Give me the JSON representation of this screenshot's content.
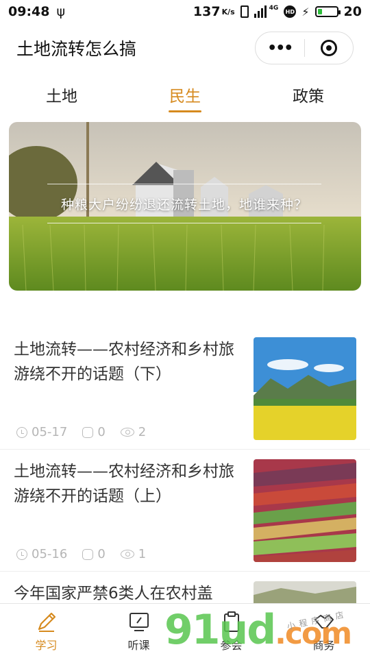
{
  "status_bar": {
    "time": "09:48",
    "usb_icon": "ψ",
    "network_speed": "137",
    "network_unit": "K/s",
    "signal_label": "4G",
    "battery": "20"
  },
  "title_bar": {
    "title": "土地流转怎么搞",
    "more_glyph": "•••"
  },
  "tabs": [
    {
      "label": "土地",
      "active": false
    },
    {
      "label": "民生",
      "active": true
    },
    {
      "label": "政策",
      "active": false
    }
  ],
  "banner": {
    "caption": "种粮大户纷纷退还流转土地，地谁来种？"
  },
  "articles": [
    {
      "title": "土地流转——农村经济和乡村旅游绕不开的话题（下）",
      "date": "05-17",
      "comments": "0",
      "views": "2",
      "thumb_icon": "mountain-rapeseed-field"
    },
    {
      "title": "土地流转——农村经济和乡村旅游绕不开的话题（上）",
      "date": "05-16",
      "comments": "0",
      "views": "1",
      "thumb_icon": "colorful-terraced-fields"
    },
    {
      "title": "今年国家严禁6类人在农村盖",
      "thumb_icon": "landscape"
    }
  ],
  "bottom_nav": [
    {
      "label": "学习",
      "icon": "pencil-icon",
      "active": true
    },
    {
      "label": "听课",
      "icon": "monitor-icon",
      "active": false
    },
    {
      "label": "参会",
      "icon": "clipboard-icon",
      "active": false
    },
    {
      "label": "商务",
      "icon": "handshake-icon",
      "active": false
    }
  ],
  "watermark": {
    "text": "91ud",
    "domain": ".com",
    "tag": "小程序商店"
  },
  "colors": {
    "accent": "#d68a1e",
    "meta": "#b5b5b5",
    "battery_fill": "#2dbd3b"
  }
}
